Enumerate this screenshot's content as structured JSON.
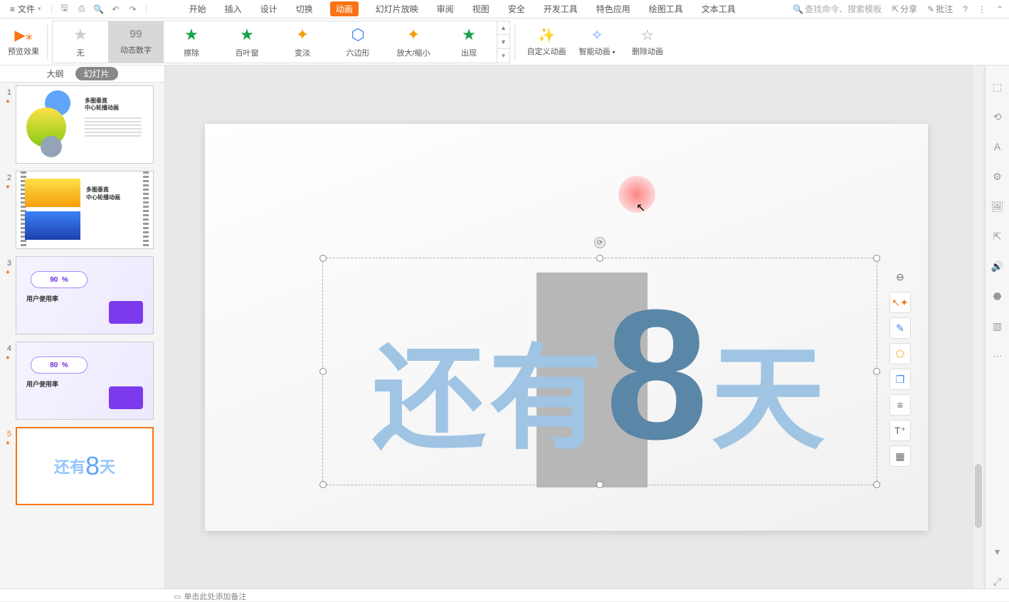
{
  "topbar": {
    "file_label": "文件",
    "tabs": [
      "开始",
      "插入",
      "设计",
      "切换",
      "动画",
      "幻灯片放映",
      "审阅",
      "视图",
      "安全",
      "开发工具",
      "特色应用",
      "绘图工具",
      "文本工具"
    ],
    "active_tab_index": 4,
    "search_placeholder": "查找命令、搜索模板",
    "share_label": "分享",
    "comment_label": "批注"
  },
  "ribbon": {
    "preview_label": "预览效果",
    "anim_items": [
      {
        "label": "无",
        "icon": "star-none"
      },
      {
        "label": "动态数字",
        "icon": "star-dyn"
      },
      {
        "label": "擦除",
        "icon": "star-green"
      },
      {
        "label": "百叶窗",
        "icon": "star-green"
      },
      {
        "label": "变淡",
        "icon": "star-orange"
      },
      {
        "label": "六边形",
        "icon": "hex-blue"
      },
      {
        "label": "放大/缩小",
        "icon": "star-orange"
      },
      {
        "label": "出现",
        "icon": "star-green"
      }
    ],
    "selected_anim_index": 1,
    "custom_anim_label": "自定义动画",
    "smart_anim_label": "智能动画",
    "delete_anim_label": "删除动画"
  },
  "left_panel": {
    "outline_label": "大纲",
    "slides_label": "幻灯片",
    "thumbs": [
      {
        "num": "1",
        "title": "多图垂直\n中心轮播动画"
      },
      {
        "num": "2",
        "title": "多图垂直\n中心轮播动画"
      },
      {
        "num": "3",
        "percent": "90",
        "percent_suffix": "%",
        "sub": "用户使用率"
      },
      {
        "num": "4",
        "percent": "80",
        "percent_suffix": "%",
        "sub": "用户使用率"
      },
      {
        "num": "5",
        "text_a": "还有",
        "text_big": "8",
        "text_b": "天"
      }
    ],
    "active_thumb": 5
  },
  "canvas": {
    "text_prefix": "还有",
    "text_big": "8",
    "text_suffix": "天"
  },
  "float_toolbar_icons": [
    "collapse",
    "cursor",
    "brush",
    "bucket",
    "layers",
    "align",
    "textfx",
    "grid"
  ],
  "right_rail_icons": [
    "select",
    "shape",
    "fontfx",
    "settings",
    "image",
    "export",
    "audio",
    "3d",
    "template",
    "more",
    "down",
    "expand"
  ],
  "statusbar": {
    "notes_hint": "单击此处添加备注"
  }
}
